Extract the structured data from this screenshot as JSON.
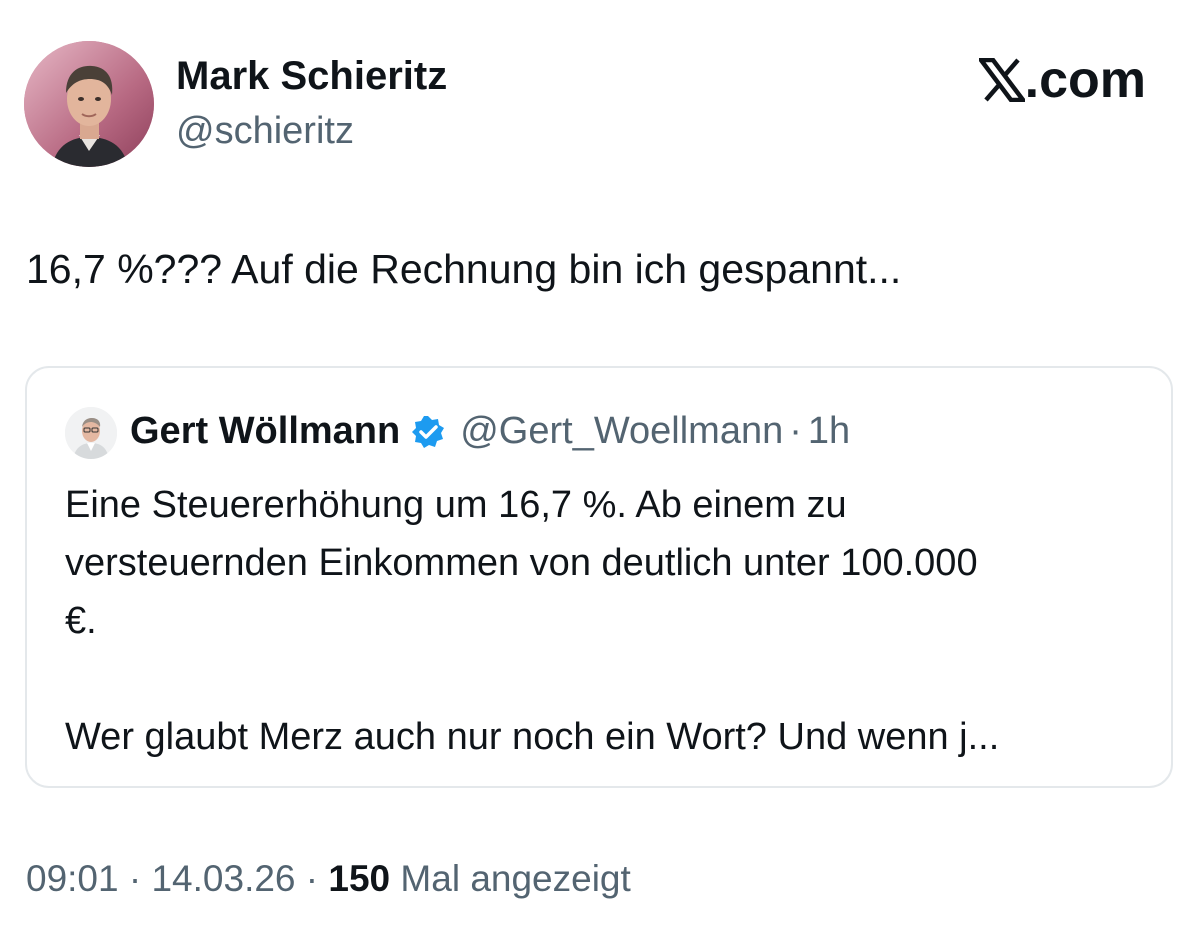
{
  "author": {
    "name": "Mark Schieritz",
    "handle": "@schieritz"
  },
  "brand": {
    "label": ".com"
  },
  "tweet": {
    "text": "16,7 %??? Auf die Rechnung bin ich gespannt..."
  },
  "quote": {
    "name": "Gert Wöllmann",
    "handle": "@Gert_Woellmann",
    "separator": "·",
    "time": "1h",
    "lines": [
      "Eine Steuererhöhung um 16,7 %. Ab einem zu",
      "versteuernden Einkommen von deutlich unter 100.000",
      "€."
    ],
    "last_line": "Wer glaubt Merz auch nur noch ein Wort? Und wenn j..."
  },
  "meta": {
    "time": "09:01",
    "sep1": "·",
    "date": "14.03.26",
    "sep2": "·",
    "views_count": "150",
    "views_label": "Mal angezeigt"
  },
  "colors": {
    "text": "#0f1419",
    "secondary": "#536471",
    "verified": "#1d9bf0",
    "card_border": "#e4e8eb"
  },
  "icons": {
    "verified": "verified-badge-icon",
    "brand": "x-logo-icon"
  }
}
